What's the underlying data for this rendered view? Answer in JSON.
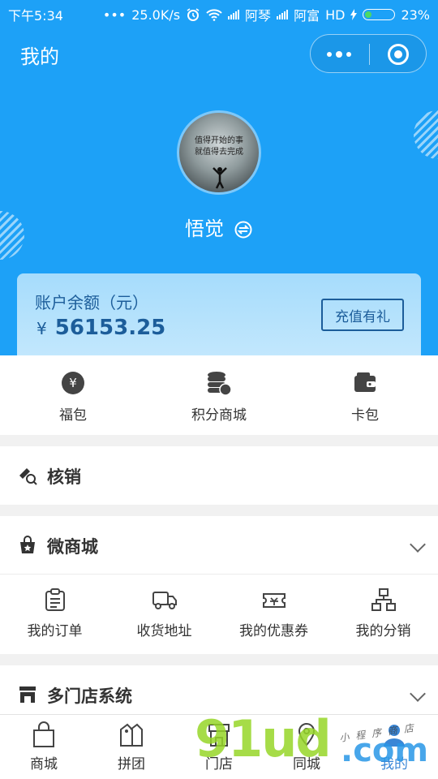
{
  "status_bar": {
    "time": "下午5:34",
    "speed": "25.0K/s",
    "carrier1": "阿琴",
    "carrier2": "阿富",
    "hd": "HD",
    "battery": "23%",
    "battery_level": 0.23
  },
  "header": {
    "title": "我的"
  },
  "profile": {
    "avatar_text": [
      "值得开始的事",
      "就值得去完成"
    ],
    "username": "悟觉"
  },
  "balance": {
    "label": "账户余额（元）",
    "currency": "¥",
    "amount": "56153.25",
    "recharge_label": "充值有礼"
  },
  "quick_actions": [
    {
      "label": "福包",
      "icon": "red-packet-icon"
    },
    {
      "label": "积分商城",
      "icon": "coins-icon"
    },
    {
      "label": "卡包",
      "icon": "wallet-icon"
    }
  ],
  "verify": {
    "label": "核销",
    "icon": "ticket-verify-icon"
  },
  "mall": {
    "label": "微商城",
    "icon": "shop-bag-icon"
  },
  "mall_items": [
    {
      "label": "我的订单",
      "icon": "clipboard-icon"
    },
    {
      "label": "收货地址",
      "icon": "truck-icon"
    },
    {
      "label": "我的优惠券",
      "icon": "coupon-icon"
    },
    {
      "label": "我的分销",
      "icon": "hierarchy-icon"
    }
  ],
  "stores": {
    "label": "多门店系统",
    "icon": "store-icon"
  },
  "tabbar": [
    {
      "label": "商城",
      "icon": "shopping-bag-icon",
      "active": false
    },
    {
      "label": "拼团",
      "icon": "tag-icon",
      "active": false
    },
    {
      "label": "门店",
      "icon": "store-icon",
      "active": false
    },
    {
      "label": "同城",
      "icon": "location-icon",
      "active": false
    },
    {
      "label": "我的",
      "icon": "user-icon",
      "active": true
    }
  ],
  "watermark": {
    "text": "91ud",
    "suffix": ".com",
    "tagline": "小程序商店"
  },
  "colors": {
    "primary": "#1da1f7",
    "accent": "#1c5d9a",
    "active_tab": "#3a86d6"
  }
}
